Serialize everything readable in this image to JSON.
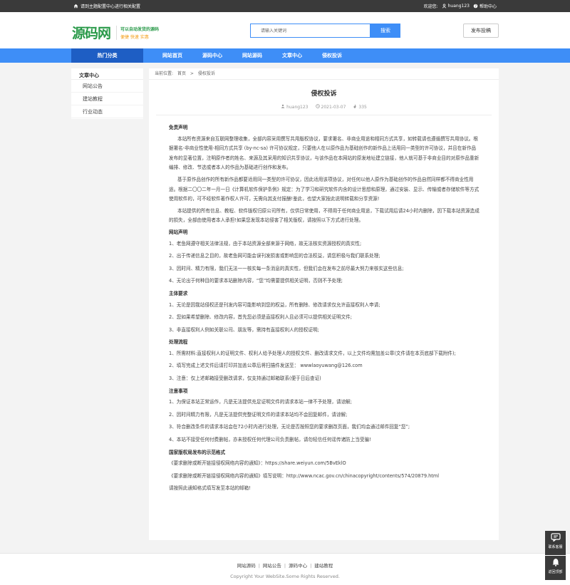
{
  "topbar": {
    "notice": "请到主题配置中心进行相关配置",
    "welcome": "欢迎您:",
    "username": "huang123",
    "help": "帮助中心"
  },
  "header": {
    "logo_text": "源码网",
    "slogan_line1": "可以自动发货的源码",
    "slogan_line2": "便捷  快速  实惠",
    "search_placeholder": "请输入关键词",
    "search_button": "搜索",
    "post_button": "发布投稿"
  },
  "nav": {
    "category": "热门分类",
    "items": [
      "网站首页",
      "源码中心",
      "网站源码",
      "文章中心",
      "侵权投诉"
    ]
  },
  "sidebar": {
    "title": "文章中心",
    "items": [
      "网站公告",
      "建站教程",
      "行业动态"
    ]
  },
  "breadcrumb": {
    "label": "当前位置:",
    "home": "首页",
    "sep": ">",
    "current": "侵权投诉"
  },
  "article": {
    "title": "侵权投诉",
    "author": "huang123",
    "date": "2021-03-07",
    "views": "335",
    "sections": [
      {
        "type": "h",
        "text": "免责声明"
      },
      {
        "type": "p",
        "text": "本站所有资源来自互联网整理收集，全部内容采用撰写共用版权协议，要求署名、非商业用途和相同方式共享，如转载请也遵循撰写共用协议。根据署名-非商业性使用-相同方式共享 (by-nc-sa) 许可协议规定，只要他人在以原作品为基础创作的新作品上适用同一类型的许可协议，并且在新作品发布的显著位置，注明原作者的姓名、来源及其采用的知识共享协议，与该作品在本网站的原发地址建立链接，他人就可基于非商业目的对原作品重新编排、修改、节选或者本人的作品为基础进行创作和发布。"
      },
      {
        "type": "p",
        "text": "基于原作品创作的所有新作品都要适用同一类型的许可协议，因此适用该项协议，对任何以他人原作为基础创作的作品自然同样都不得商业性用途。根据二〇〇二年一月一日《计算机软件保护条例》规定：为了学习和研究软件内含的设计思想和原理，通过安装、显示、传输或者存储软件等方式使用软件的，可不经软件著作权人许可，无需向其支付报酬!鉴此，也望大家按此说明转载和分享资源!"
      },
      {
        "type": "p",
        "text": "本站提供的所有信息、教程、软件版权归原公司所有，仅供日常使用，不得用于任何商业用途，下载试用后请24小时内删除，因下载本站资源造成的损失，全部由使用者本人承担!如果您发现本站侵害了相关版权，请按照以下方式进行处理。"
      },
      {
        "type": "h",
        "text": "网站声明"
      },
      {
        "type": "l",
        "text": "1、老鱼网遵守相关法律法规，由于本站资源全部来源于网络，故无法核实资源授权的真实性;"
      },
      {
        "type": "l",
        "text": "2、出于传递信息之目的，故老鱼网可能会误刊发损害或影响您的合法权益，请您积极与我们联系处理;"
      },
      {
        "type": "l",
        "text": "3、因时间、精力有限，我们无法一一核实每一条消息的真实性，但我们会在发布之前尽最大努力来核实这些信息;"
      },
      {
        "type": "l",
        "text": "4、无论出于何种目的要求本站删除内容，“您”均需要提供相关证明，否则不予处理;"
      },
      {
        "type": "h",
        "text": "主体要求"
      },
      {
        "type": "l",
        "text": "1、无论是因我站侵权还是刊发内容可能影响到您的权益，所有删除、修改请求仅允许直接权利人申请;"
      },
      {
        "type": "l",
        "text": "2、您如果希望删除、修改内容，首先您必须是直接权利人且必须可以提供相关证明文件;"
      },
      {
        "type": "l",
        "text": "3、非直接权利人例如关联公司、朋友等，需持有直接权利人的授权证明;"
      },
      {
        "type": "h",
        "text": "处理流程"
      },
      {
        "type": "l",
        "text": "1、所需材料:直接权利人的证明文件、权利人给予处理人的授权文件、删改请求文件，以上文件均需加盖公章(文件请在本页底部下载附件);"
      },
      {
        "type": "l",
        "text": "2、填写完成上述文件后请打印并加盖公章后将扫描件发送至： wwwlaoyuwang@126.com"
      },
      {
        "type": "l",
        "text": "3、注意：仅上述邮箱接受删改请求，仅支持通过邮箱联系(便于日后查证)"
      },
      {
        "type": "h",
        "text": "注意事项"
      },
      {
        "type": "l",
        "text": "1、为保证本站正常运作，凡是无法提供充足证明文件的请求本站一律不予处理，请谅解;"
      },
      {
        "type": "l",
        "text": "2、因时间精力有限，凡是无法提供完整证明文件的请求本站均不会回复邮件，请谅解;"
      },
      {
        "type": "l",
        "text": "3、符合删改条件的请求本站会在72小时内进行处理，无论是否按照您的要求删改页面，我们均会通过邮件回复“您”;"
      },
      {
        "type": "l",
        "text": "4、本站不接受任何付费删帖，亦未授权任何代理公司负责删帖，请勿轻信任何谣传诸防上当受骗!"
      },
      {
        "type": "h",
        "text": "国家版权局发布的示范格式"
      },
      {
        "type": "l",
        "text": "《要求删除或断开链接侵权网络内容的通知》：https://share.weiyun.com/5BvEklO"
      },
      {
        "type": "l",
        "text": "《要求删除或断开链接侵权网络内容的通知》填写说明：http://www.ncac.gov.cn/chinacopyright/contents/574/20879.html"
      },
      {
        "type": "l",
        "text": "请按照此通知格式填写发至本站的邮箱!"
      }
    ]
  },
  "footer": {
    "links": [
      "网站源码",
      "网站公告",
      "源码中心",
      "建站教程"
    ],
    "copyright": "Copyright Your WebSite.Some Rights Reserved."
  },
  "float": {
    "contact": "联系客服",
    "top": "返回顶部"
  }
}
